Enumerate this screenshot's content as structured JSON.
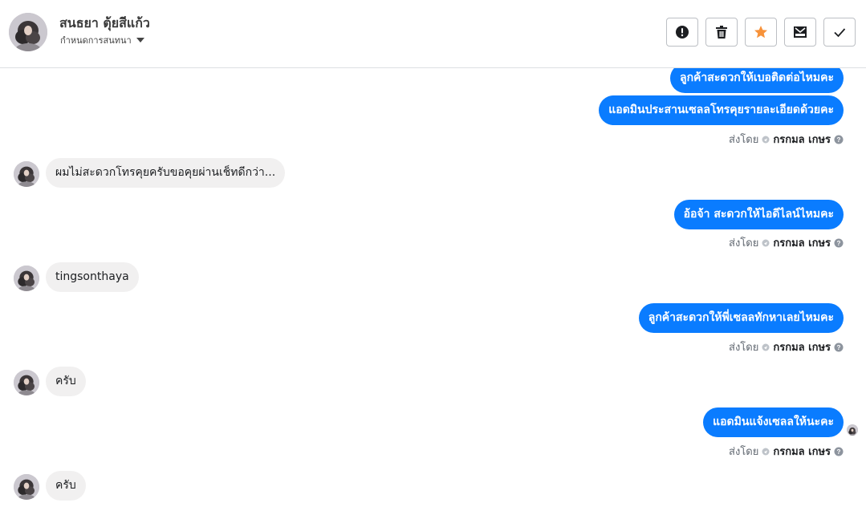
{
  "header": {
    "contact_name": "สนธยา ตุ้ยสีแก้ว",
    "conversation_settings_label": "กำหนดการสนทนา",
    "toolbar": [
      {
        "icon": "alert-icon",
        "label": "Mark as spam"
      },
      {
        "icon": "trash-icon",
        "label": "Delete"
      },
      {
        "icon": "star-icon",
        "label": "Star",
        "color": "#f7923a"
      },
      {
        "icon": "mark-unread-icon",
        "label": "Mark as unread"
      },
      {
        "icon": "check-icon",
        "label": "Mark as done"
      }
    ]
  },
  "colors": {
    "outgoing_bubble": "#0a7cff",
    "incoming_bubble": "#f1f0f0",
    "star": "#f7923a"
  },
  "messages": [
    {
      "direction": "out",
      "text": "ลูกค้าสะดวกให้เบอติดต่อไหมคะ"
    },
    {
      "direction": "out",
      "text": "แอดมินประสานเซลลโทรคุยรายละเอียดด้วยคะ",
      "sent_by_prefix": "ส่งโดย",
      "sender": "กรกมล เกษร"
    },
    {
      "direction": "in",
      "text": "ผมไม่สะดวกโทรคุยครับขอคุยผ่านเช็ทดีกว่า..."
    },
    {
      "direction": "out",
      "text": "อ้อจ้า สะดวกให้ไอดีไลน์ไหมคะ",
      "sent_by_prefix": "ส่งโดย",
      "sender": "กรกมล เกษร"
    },
    {
      "direction": "in",
      "text": "tingsonthaya"
    },
    {
      "direction": "out",
      "text": "ลูกค้าสะดวกให้พี่เซลลทักหาเลยไหมคะ",
      "sent_by_prefix": "ส่งโดย",
      "sender": "กรกมล เกษร"
    },
    {
      "direction": "in",
      "text": "ครับ"
    },
    {
      "direction": "out",
      "text": "แอดมินแจ้งเซลลให้นะคะ",
      "sent_by_prefix": "ส่งโดย",
      "sender": "กรกมล เกษร"
    },
    {
      "direction": "in",
      "text": "ครับ"
    }
  ]
}
